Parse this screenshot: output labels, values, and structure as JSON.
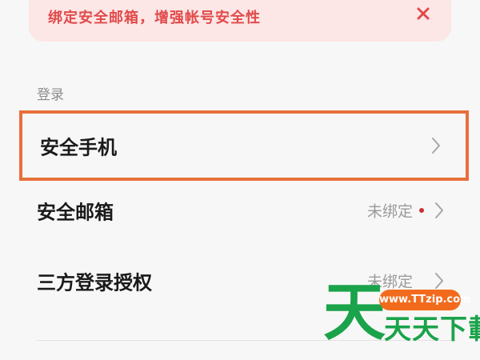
{
  "banner": {
    "text": "绑定安全邮箱，增强帐号安全性",
    "close_icon": "close-icon",
    "text_color": "#e24a4a",
    "background": "#fde6e6"
  },
  "section": {
    "label": "登录"
  },
  "rows": [
    {
      "label": "安全手机",
      "status": "",
      "icon": "chevron-right-icon"
    },
    {
      "label": "安全邮箱",
      "status": "未绑定",
      "dot_color": "#c83232",
      "icon": "chevron-right-icon"
    },
    {
      "label": "三方登录授权",
      "status": "未绑定",
      "icon": "chevron-right-icon"
    }
  ],
  "highlight": {
    "color": "#e86f3c"
  },
  "watermark": {
    "big_char": "天",
    "pill": "www.TTzip.com",
    "text": "天天下載",
    "green": "#1aa34a",
    "orange": "#f26b1d"
  }
}
